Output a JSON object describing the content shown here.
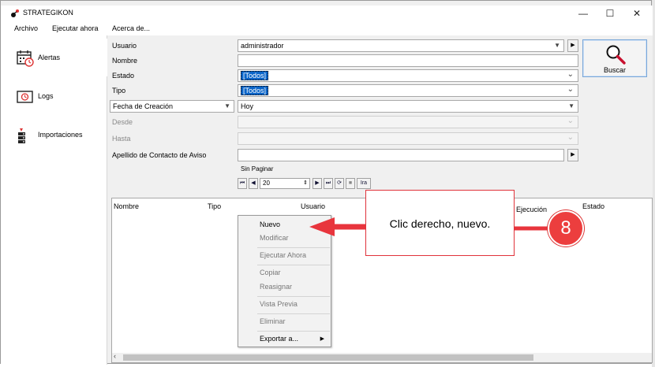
{
  "window": {
    "title": "STRATEGIKON",
    "minimize": "—",
    "maximize": "☐",
    "close": "✕"
  },
  "menu": [
    "Archivo",
    "Ejecutar ahora",
    "Acerca de..."
  ],
  "sidebar": [
    {
      "label": "Alertas",
      "icon": "calendar-alert-icon"
    },
    {
      "label": "Logs",
      "icon": "clock-log-icon"
    },
    {
      "label": "Importaciones",
      "icon": "import-icon"
    }
  ],
  "form": {
    "usuario": {
      "label": "Usuario",
      "value": "administrador"
    },
    "nombre": {
      "label": "Nombre",
      "value": ""
    },
    "estado": {
      "label": "Estado",
      "value": "[Todos]"
    },
    "tipo": {
      "label": "Tipo",
      "value": "[Todos]"
    },
    "fecha": {
      "label": "Fecha de Creación",
      "value": "Hoy"
    },
    "desde": {
      "label": "Desde",
      "value": ""
    },
    "hasta": {
      "label": "Hasta",
      "value": ""
    },
    "apellido": {
      "label": "Apellido de Contacto de Aviso",
      "value": ""
    },
    "buscar_label": "Buscar"
  },
  "pager": {
    "label": "Sin Paginar",
    "page_size": "20",
    "go_label": "Ira"
  },
  "grid": {
    "columns": [
      "Nombre",
      "Tipo",
      "Usuario",
      "Ejecución",
      "Estado"
    ]
  },
  "context_menu": [
    {
      "label": "Nuevo",
      "enabled": true
    },
    {
      "label": "Modificar",
      "enabled": false
    },
    {
      "label": "Ejecutar Ahora",
      "enabled": false
    },
    {
      "label": "Copiar",
      "enabled": false
    },
    {
      "label": "Reasignar",
      "enabled": false
    },
    {
      "label": "Vista Previa",
      "enabled": false
    },
    {
      "label": "Eliminar",
      "enabled": false
    },
    {
      "label": "Exportar a...",
      "enabled": true
    }
  ],
  "callout": {
    "text": "Clic derecho, nuevo.",
    "step": "8"
  },
  "colors": {
    "accent": "#e0323a",
    "selection": "#0a64c8"
  }
}
